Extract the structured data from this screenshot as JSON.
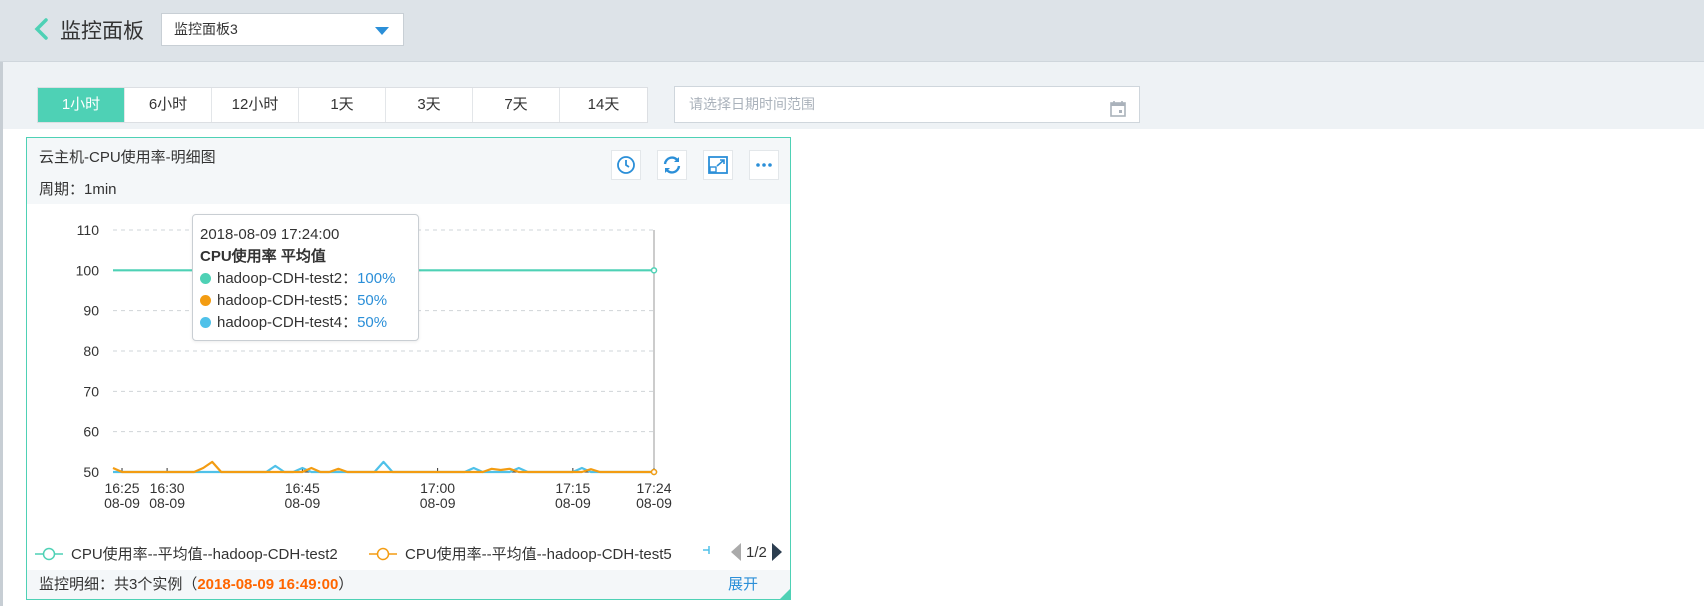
{
  "header": {
    "title": "监控面板",
    "dashboard_select": "监控面板3"
  },
  "time_tabs": [
    {
      "label": "1小时",
      "active": true
    },
    {
      "label": "6小时",
      "active": false
    },
    {
      "label": "12小时",
      "active": false
    },
    {
      "label": "1天",
      "active": false
    },
    {
      "label": "3天",
      "active": false
    },
    {
      "label": "7天",
      "active": false
    },
    {
      "label": "14天",
      "active": false
    }
  ],
  "date_range": {
    "placeholder": "请选择日期时间范围"
  },
  "panel": {
    "title": "云主机-CPU使用率-明细图",
    "period": "周期：1min",
    "tools": [
      "clock-icon",
      "refresh-icon",
      "expand-icon",
      "more-icon"
    ]
  },
  "tooltip": {
    "time": "2018-08-09 17:24:00",
    "heading": "CPU使用率 平均值",
    "rows": [
      {
        "name": "hadoop-CDH-test2",
        "value": "100%",
        "color": "#4ed1b5"
      },
      {
        "name": "hadoop-CDH-test5",
        "value": "50%",
        "color": "#f39c12"
      },
      {
        "name": "hadoop-CDH-test4",
        "value": "50%",
        "color": "#4fc1e9"
      }
    ]
  },
  "legend": {
    "items": [
      {
        "label": "CPU使用率--平均值--hadoop-CDH-test2",
        "color": "#4ed1b5"
      },
      {
        "label": "CPU使用率--平均值--hadoop-CDH-test5",
        "color": "#f39c12"
      }
    ],
    "page": "1/2"
  },
  "footer": {
    "prefix": "监控明细：共3个实例（",
    "time": "2018-08-09 16:49:00",
    "suffix": "）",
    "expand": "展开"
  },
  "chart_data": {
    "type": "line",
    "ylim": [
      50,
      110
    ],
    "yticks": [
      50,
      60,
      70,
      80,
      90,
      100,
      110
    ],
    "xticks": [
      {
        "time": "16:25",
        "date": "08-09",
        "minute": 1
      },
      {
        "time": "16:30",
        "date": "08-09",
        "minute": 6
      },
      {
        "time": "16:45",
        "date": "08-09",
        "minute": 21
      },
      {
        "time": "17:00",
        "date": "08-09",
        "minute": 36
      },
      {
        "time": "17:15",
        "date": "08-09",
        "minute": 51
      },
      {
        "time": "17:24",
        "date": "08-09",
        "minute": 60
      }
    ],
    "xlim": [
      0,
      60
    ],
    "series": [
      {
        "name": "hadoop-CDH-test2",
        "color": "#4ed1b5",
        "values": [
          [
            0,
            100
          ],
          [
            60,
            100
          ]
        ]
      },
      {
        "name": "hadoop-CDH-test5",
        "color": "#f39c12",
        "values": [
          [
            0,
            51
          ],
          [
            1,
            50
          ],
          [
            9,
            50
          ],
          [
            10,
            51
          ],
          [
            11,
            52.5
          ],
          [
            12,
            50
          ],
          [
            21,
            50
          ],
          [
            22,
            51
          ],
          [
            23,
            50
          ],
          [
            24,
            50
          ],
          [
            25,
            50.8
          ],
          [
            26,
            50
          ],
          [
            41,
            50
          ],
          [
            42,
            50.8
          ],
          [
            43,
            50.5
          ],
          [
            44,
            50.8
          ],
          [
            45,
            50
          ],
          [
            52,
            50
          ],
          [
            53,
            50.7
          ],
          [
            54,
            50
          ],
          [
            60,
            50
          ]
        ]
      },
      {
        "name": "hadoop-CDH-test4",
        "color": "#4fc1e9",
        "values": [
          [
            0,
            50
          ],
          [
            17,
            50
          ],
          [
            18,
            51.5
          ],
          [
            19,
            50
          ],
          [
            20,
            50
          ],
          [
            21,
            51
          ],
          [
            22,
            50
          ],
          [
            29,
            50
          ],
          [
            30,
            52.5
          ],
          [
            31,
            50
          ],
          [
            39,
            50
          ],
          [
            40,
            51
          ],
          [
            41,
            50
          ],
          [
            44,
            50
          ],
          [
            45,
            51
          ],
          [
            46,
            50
          ],
          [
            51,
            50
          ],
          [
            52,
            51
          ],
          [
            53,
            50
          ],
          [
            60,
            50
          ]
        ]
      }
    ]
  }
}
